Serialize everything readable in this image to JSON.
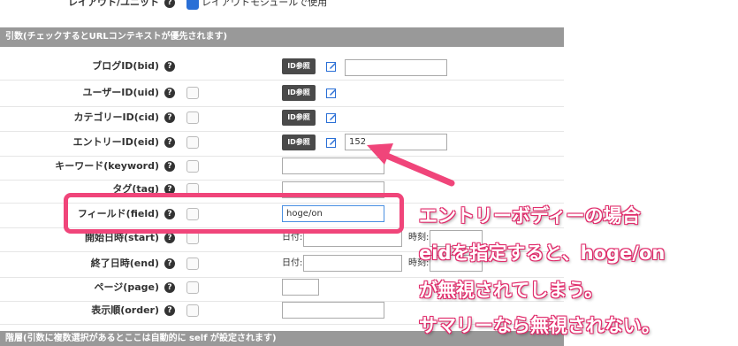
{
  "top": {
    "label": "レイアウト/ユニット",
    "checkbox_label": "レイアウトモジュールで使用"
  },
  "section_args": "引数(チェックするとURLコンテキストが優先されます)",
  "section_bottom": "階層(引数に複数選択があるとここは自動的に self が設定されます)",
  "rows": [
    {
      "label": "ブログID(bid)",
      "button": "ID参照",
      "value": ""
    },
    {
      "label": "ユーザーID(uid)",
      "button": "ID参照"
    },
    {
      "label": "カテゴリーID(cid)",
      "button": "ID参照"
    },
    {
      "label": "エントリーID(eid)",
      "button": "ID参照",
      "value": "152"
    },
    {
      "label": "キーワード(keyword)",
      "value": ""
    },
    {
      "label": "タグ(tag)",
      "value": ""
    },
    {
      "label": "フィールド(field)",
      "value": "hoge/on"
    },
    {
      "label": "開始日時(start)",
      "date_label": "日付:",
      "time_label": "時刻:"
    },
    {
      "label": "終了日時(end)",
      "date_label": "日付:",
      "time_label": "時刻:"
    },
    {
      "label": "ページ(page)",
      "value": ""
    },
    {
      "label": "表示順(order)",
      "value": ""
    }
  ],
  "help_glyph": "?",
  "annotation": {
    "line1": "エントリーボディーの場合",
    "line2": "eidを指定すると、hoge/on",
    "line3": "が無視されてしまう。",
    "line4": "サマリーなら無視されない。"
  },
  "colors": {
    "accent": "#f0457a",
    "header_bg": "#999999",
    "button_bg": "#4a4a4a",
    "check_on": "#2a6fd6"
  }
}
